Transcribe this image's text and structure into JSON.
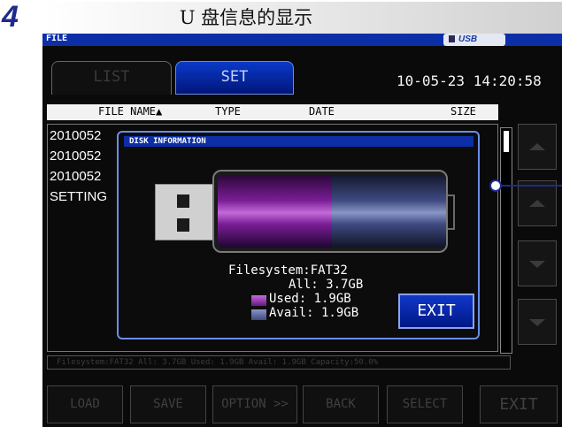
{
  "step_number": "4",
  "heading": "U 盘信息的显示",
  "window": {
    "title": "FILE",
    "usb_badge": "USB"
  },
  "tabs": [
    {
      "label": "LIST",
      "active": false
    },
    {
      "label": "SET",
      "active": true
    }
  ],
  "datetime": "10-05-23 14:20:58",
  "file_list": {
    "columns": [
      "FILE NAME▲",
      "TYPE",
      "DATE",
      "SIZE"
    ],
    "rows": [
      "2010052",
      "2010052",
      "2010052",
      "SETTING"
    ]
  },
  "status_line": "Filesystem:FAT32 All: 3.7GB Used: 1.9GB Avail: 1.9GB Capacity:50.0%",
  "dialog": {
    "title": "DISK INFORMATION",
    "filesystem": "Filesystem:FAT32",
    "all": "All: 3.7GB",
    "used": "Used: 1.9GB",
    "avail": "Avail: 1.9GB",
    "used_color": "#9b2fb5",
    "avail_color": "#5a64a0",
    "used_fraction": 0.5,
    "exit_label": "EXIT"
  },
  "bottom_buttons": [
    "LOAD",
    "SAVE",
    "OPTION >>",
    "BACK",
    "SELECT",
    "EXIT"
  ]
}
